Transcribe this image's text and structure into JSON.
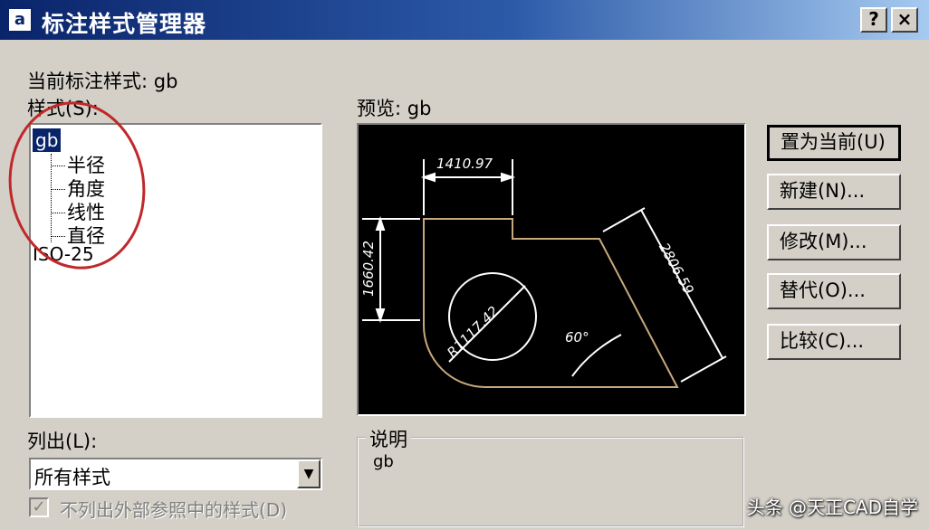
{
  "window": {
    "title": "标注样式管理器",
    "help_button": "?",
    "close_button": "×"
  },
  "current_style_label": "当前标注样式: gb",
  "styles_label": "样式(S):",
  "styles_tree": {
    "root": "gb",
    "children": [
      "半径",
      "角度",
      "线性",
      "直径"
    ],
    "other": "ISO-25"
  },
  "preview_label": "预览: gb",
  "preview": {
    "top_dimension": "1410.97",
    "left_dimension": "1660.42",
    "slant_dimension": "2806.59",
    "radius_dimension": "R1117.42",
    "angle_dimension": "60°"
  },
  "buttons": {
    "set_current": "置为当前(U)",
    "new": "新建(N)...",
    "modify": "修改(M)...",
    "override": "替代(O)...",
    "compare": "比较(C)..."
  },
  "list_label": "列出(L):",
  "list_select": {
    "value": "所有样式"
  },
  "xref_checkbox": {
    "label": "不列出外部参照中的样式(D)",
    "checked": true
  },
  "description": {
    "title": "说明",
    "text": "gb"
  },
  "watermark": "头条 @天正CAD自学",
  "colors": {
    "title_dark": "#0a246a",
    "dialog_bg": "#d4d0c8",
    "annotation_red": "#c0282a"
  }
}
